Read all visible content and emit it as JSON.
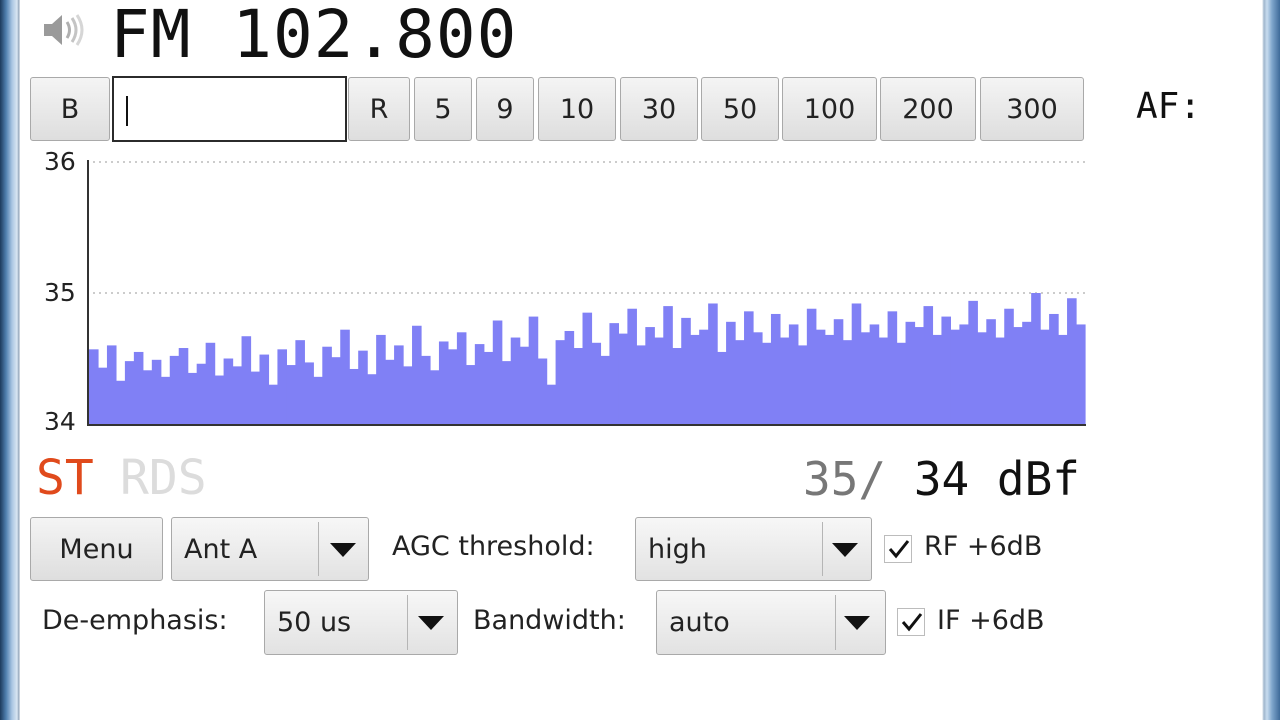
{
  "frequency": "FM 102.800",
  "af_label": "AF:",
  "toolbar": {
    "b_label": "B",
    "input_value": "",
    "r_label": "R",
    "steps": [
      "5",
      "9",
      "10",
      "30",
      "50",
      "100",
      "200",
      "300"
    ]
  },
  "chart_data": {
    "type": "area",
    "title": "",
    "xlabel": "",
    "ylabel": "",
    "ylim": [
      34,
      36
    ],
    "yticks": [
      "36",
      "35",
      "34"
    ],
    "grid": "dotted-horizontal",
    "color": "#8080f5",
    "series": [
      {
        "values": [
          34.57,
          34.43,
          34.6,
          34.33,
          34.48,
          34.55,
          34.41,
          34.49,
          34.36,
          34.52,
          34.58,
          34.39,
          34.46,
          34.62,
          34.37,
          34.5,
          34.44,
          34.67,
          34.4,
          34.53,
          34.3,
          34.57,
          34.45,
          34.64,
          34.47,
          34.36,
          34.59,
          34.51,
          34.72,
          34.42,
          34.56,
          34.38,
          34.68,
          34.49,
          34.6,
          34.44,
          34.75,
          34.52,
          34.41,
          34.63,
          34.57,
          34.7,
          34.45,
          34.61,
          34.55,
          34.79,
          34.48,
          34.66,
          34.59,
          34.82,
          34.5,
          34.3,
          34.64,
          34.71,
          34.58,
          34.85,
          34.62,
          34.52,
          34.77,
          34.69,
          34.88,
          34.6,
          34.74,
          34.66,
          34.9,
          34.58,
          34.81,
          34.68,
          34.72,
          34.92,
          34.55,
          34.78,
          34.64,
          34.86,
          34.7,
          34.62,
          34.84,
          34.66,
          34.76,
          34.6,
          34.88,
          34.72,
          34.68,
          34.8,
          34.64,
          34.92,
          34.7,
          34.76,
          34.66,
          34.86,
          34.62,
          34.78,
          34.74,
          34.9,
          34.68,
          34.82,
          34.72,
          34.76,
          34.94,
          34.7,
          34.8,
          34.66,
          34.88,
          34.74,
          34.78,
          35.0,
          34.72,
          34.84,
          34.68,
          34.96,
          34.76
        ]
      }
    ]
  },
  "indicators": {
    "stereo": "ST",
    "rds": "RDS"
  },
  "signal": {
    "peak": "35/",
    "current": " 34 dBf"
  },
  "controls": {
    "menu_label": "Menu",
    "antenna": "Ant A",
    "agc_label": "AGC threshold:",
    "agc_value": "high",
    "rf_label": "RF +6dB",
    "rf_checked": true,
    "deemph_label": "De-emphasis:",
    "deemph_value": "50 us",
    "bandwidth_label": "Bandwidth:",
    "bandwidth_value": "auto",
    "if_label": "IF +6dB",
    "if_checked": true
  }
}
